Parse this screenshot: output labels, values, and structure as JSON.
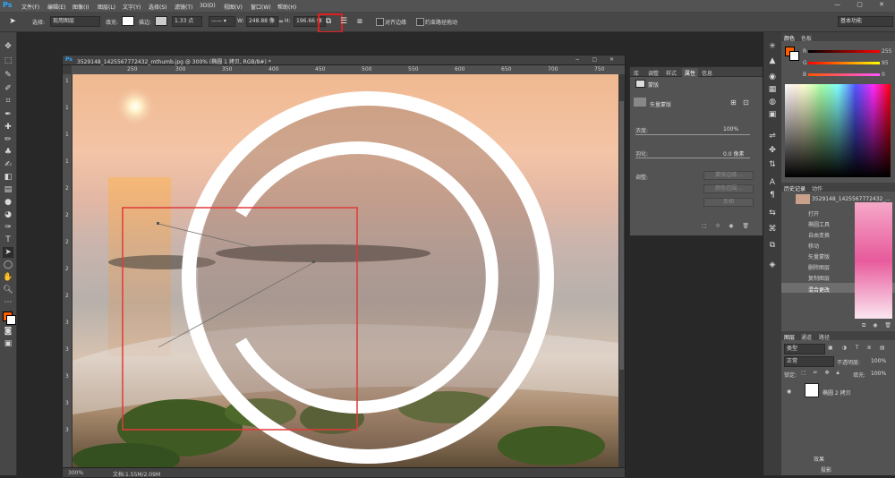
{
  "menubar": {
    "logo": "Ps",
    "items": [
      "文件(F)",
      "编辑(E)",
      "图像(I)",
      "图层(L)",
      "文字(Y)",
      "选择(S)",
      "滤镜(T)",
      "3D(D)",
      "视图(V)",
      "窗口(W)",
      "帮助(H)"
    ],
    "window_controls": "— ▢ ✕"
  },
  "options": {
    "select_label": "选择:",
    "select_value": "现用图层",
    "fill_label": "填充:",
    "stroke_label": "描边:",
    "stroke_width": "1.33 点",
    "w_label": "W:",
    "w_value": "248.88 像",
    "h_label": "H:",
    "h_value": "196.66 像",
    "align_edges": "对齐边缘",
    "constrain_path": "约束路径拖动",
    "workspace": "基本功能"
  },
  "document": {
    "tab_title": "3529148_1425567772432_mthumb.jpg @ 300% (椭圆 1 拷贝, RGB/8#) *",
    "zoom": "300%",
    "doc_info": "文档:1.55M/2.09M",
    "ruler_h": [
      "250",
      "300",
      "350",
      "400",
      "450",
      "500",
      "550",
      "600",
      "650",
      "700",
      "750"
    ],
    "ruler_v": [
      "1",
      "1",
      "1",
      "1",
      "2",
      "2",
      "2",
      "2",
      "2",
      "3",
      "3",
      "3",
      "3",
      "3"
    ]
  },
  "properties": {
    "tabs": [
      "库",
      "调整",
      "样式",
      "属性",
      "信息"
    ],
    "section": "蒙版",
    "mask_label": "矢量蒙版",
    "density_label": "浓度:",
    "density_value": "100%",
    "feather_label": "羽化:",
    "feather_value": "0.0 像素",
    "refine_label": "调整:",
    "btn_mask_edge": "蒙版边缘...",
    "btn_color_range": "颜色范围...",
    "btn_invert": "反相"
  },
  "color_panel": {
    "tabs": [
      "颜色",
      "色板"
    ],
    "r_label": "R",
    "g_label": "G",
    "b_label": "B",
    "r_value": "255",
    "g_value": "95",
    "b_value": "0",
    "accent": "#ff5f00"
  },
  "history": {
    "tabs": [
      "历史记录",
      "动作"
    ],
    "snapshot": "3529148_1425567772432_...",
    "items": [
      "打开",
      "椭圆工具",
      "自由变换",
      "移动",
      "矢量蒙版",
      "删除图层",
      "复制图层",
      "混合更改"
    ]
  },
  "layers": {
    "tabs": [
      "图层",
      "通道",
      "路径"
    ],
    "kind": "类型",
    "blend": "正常",
    "opacity_label": "不透明度:",
    "opacity_value": "100%",
    "lock_label": "锁定:",
    "fill_label": "填充:",
    "fill_value": "100%",
    "items": [
      "椭圆 2 拷贝",
      "效果",
      "投影"
    ]
  }
}
